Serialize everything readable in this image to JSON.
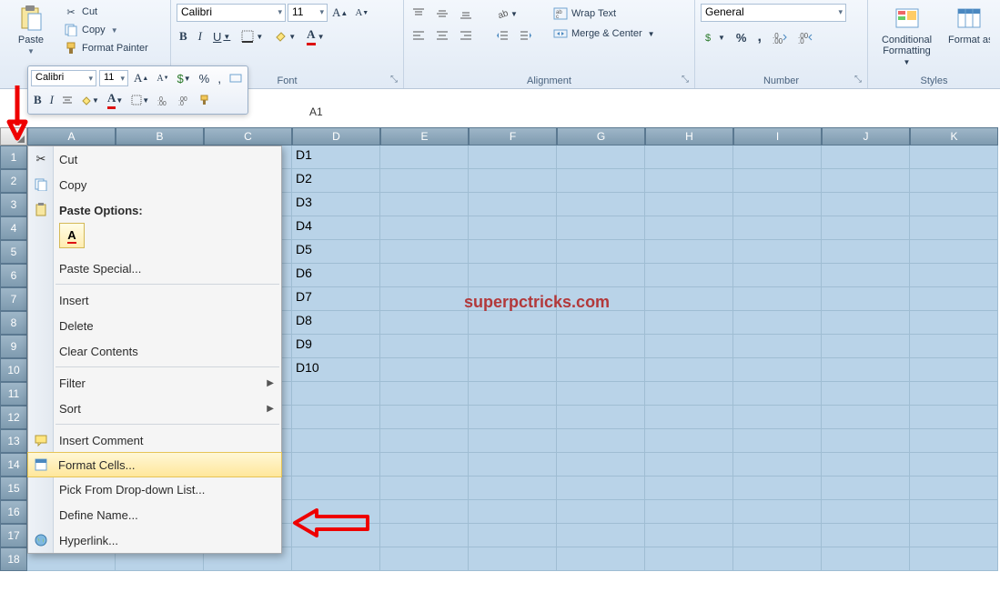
{
  "ribbon": {
    "clipboard": {
      "label": "",
      "paste": "Paste",
      "cut": "Cut",
      "copy": "Copy",
      "format_painter": "Format Painter"
    },
    "font": {
      "label": "Font",
      "font_name": "Calibri",
      "font_size": "11",
      "bold": "B",
      "italic": "I",
      "underline": "U"
    },
    "alignment": {
      "label": "Alignment",
      "wrap": "Wrap Text",
      "merge": "Merge & Center"
    },
    "number": {
      "label": "Number",
      "format": "General"
    },
    "styles": {
      "label": "Styles",
      "conditional": "Conditional Formatting",
      "format_as": "Format as Table"
    }
  },
  "mini_toolbar": {
    "font_name": "Calibri",
    "font_size": "11"
  },
  "formula_bar": {
    "ref": "A1"
  },
  "columns": [
    "A",
    "B",
    "C",
    "D",
    "E",
    "F",
    "G",
    "H",
    "I",
    "J",
    "K"
  ],
  "rows": [
    "1",
    "2",
    "3",
    "4",
    "5",
    "6",
    "7",
    "8",
    "9",
    "10",
    "11",
    "12",
    "13",
    "14",
    "15",
    "16",
    "17",
    "18"
  ],
  "data_col_d": [
    "D1",
    "D2",
    "D3",
    "D4",
    "D5",
    "D6",
    "D7",
    "D8",
    "D9",
    "D10"
  ],
  "watermark": "superpctricks.com",
  "context_menu": {
    "cut": "Cut",
    "copy": "Copy",
    "paste_options": "Paste Options:",
    "paste_special": "Paste Special...",
    "insert": "Insert",
    "delete": "Delete",
    "clear": "Clear Contents",
    "filter": "Filter",
    "sort": "Sort",
    "insert_comment": "Insert Comment",
    "format_cells": "Format Cells...",
    "pick_list": "Pick From Drop-down List...",
    "define_name": "Define Name...",
    "hyperlink": "Hyperlink..."
  }
}
